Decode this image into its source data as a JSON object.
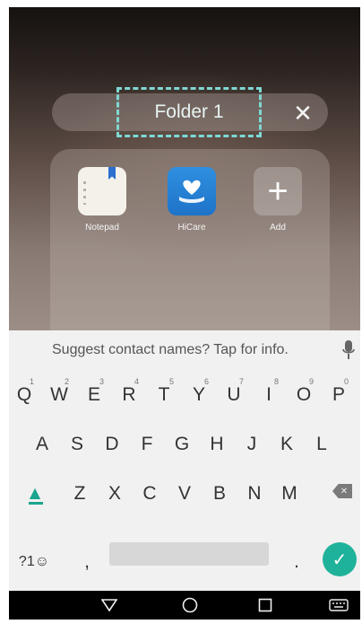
{
  "folder": {
    "title": "Folder 1",
    "apps": [
      {
        "label": "Notepad",
        "icon": "notepad-icon"
      },
      {
        "label": "HiCare",
        "icon": "hicare-heart-hand-icon"
      },
      {
        "label": "Add",
        "icon": "plus-icon"
      }
    ],
    "close_icon": "close-icon"
  },
  "keyboard": {
    "suggestion": "Suggest contact names? Tap for info.",
    "row1": [
      {
        "key": "Q",
        "hint": "1"
      },
      {
        "key": "W",
        "hint": "2"
      },
      {
        "key": "E",
        "hint": "3"
      },
      {
        "key": "R",
        "hint": "4"
      },
      {
        "key": "T",
        "hint": "5"
      },
      {
        "key": "Y",
        "hint": "6"
      },
      {
        "key": "U",
        "hint": "7"
      },
      {
        "key": "I",
        "hint": "8"
      },
      {
        "key": "O",
        "hint": "9"
      },
      {
        "key": "P",
        "hint": "0"
      }
    ],
    "row2": [
      "A",
      "S",
      "D",
      "F",
      "G",
      "H",
      "J",
      "K",
      "L"
    ],
    "row3": [
      "Z",
      "X",
      "C",
      "V",
      "B",
      "N",
      "M"
    ],
    "symbols_key": "?1☺",
    "comma_key": ",",
    "period_key": ".",
    "accent_color": "#1fb29a"
  },
  "navbar": {
    "icons": [
      "back-triangle-icon",
      "home-circle-icon",
      "recents-square-icon",
      "keyboard-switch-icon"
    ]
  }
}
